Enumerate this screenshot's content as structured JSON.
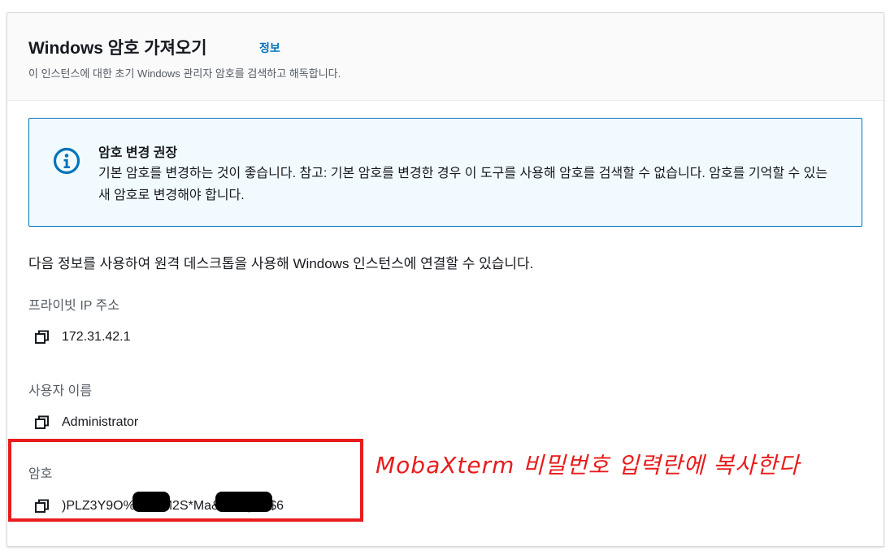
{
  "header": {
    "title": "Windows 암호 가져오기",
    "info_link": "정보",
    "subtitle": "이 인스턴스에 대한 초기 Windows 관리자 암호를 검색하고 해독합니다."
  },
  "alert": {
    "icon": "info-circle-icon",
    "title": "암호 변경 권장",
    "body": "기본 암호를 변경하는 것이 좋습니다. 참고: 기본 암호를 변경한 경우 이 도구를 사용해 암호를 검색할 수 없습니다. 암호를 기억할 수 있는 새 암호로 변경해야 합니다."
  },
  "intro": "다음 정보를 사용하여 원격 데스크톱을 사용해 Windows 인스턴스에 연결할 수 있습니다.",
  "fields": {
    "private_ip": {
      "label": "프라이빗 IP 주소",
      "value": "172.31.42.1"
    },
    "username": {
      "label": "사용자 이름",
      "value": "Administrator"
    },
    "password": {
      "label": "암호",
      "value": ")PLZ3Y9O%W3$M2S*Ma&aaD-)H4$6"
    }
  },
  "annotation": "MobaXterm 비밀번호 입력란에 복사한다",
  "colors": {
    "accent": "#0073bb",
    "alert_bg": "#f1faff",
    "annotation_red": "#e81c1c"
  }
}
